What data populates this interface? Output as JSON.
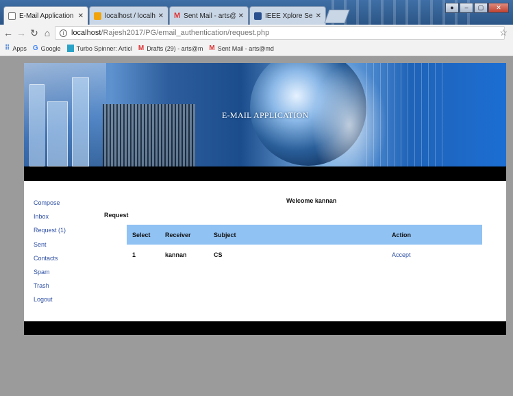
{
  "browser": {
    "tabs": [
      {
        "title": "E-Mail Application",
        "icon": "page-icon",
        "active": true
      },
      {
        "title": "localhost / localhost / g",
        "icon": "phpmyadmin-icon",
        "active": false
      },
      {
        "title": "Sent Mail - arts@mdcen",
        "icon": "gmail-icon",
        "active": false
      },
      {
        "title": "IEEE Xplore Search Resu",
        "icon": "ieee-icon",
        "active": false
      }
    ],
    "url_host": "localhost",
    "url_path": "/Rajesh2017/PG/email_authentication/request.php",
    "bookmarks": [
      {
        "label": "Apps",
        "icon": "apps-grid-icon"
      },
      {
        "label": "Google",
        "icon": "google-icon"
      },
      {
        "label": "Turbo Spinner: Articl",
        "icon": "turbo-spinner-icon"
      },
      {
        "label": "Drafts (29) - arts@m",
        "icon": "gmail-icon"
      },
      {
        "label": "Sent Mail - arts@md",
        "icon": "gmail-icon"
      }
    ]
  },
  "banner": {
    "title": "E-MAIL APPLICATION"
  },
  "welcome_text": "Welcome kannan",
  "sidebar": {
    "items": [
      {
        "label": "Compose"
      },
      {
        "label": "Inbox"
      },
      {
        "label": "Request (1)"
      },
      {
        "label": "Sent"
      },
      {
        "label": "Contacts"
      },
      {
        "label": "Spam"
      },
      {
        "label": "Trash"
      },
      {
        "label": "Logout"
      }
    ]
  },
  "request_heading": "Request",
  "table": {
    "headers": [
      "Select",
      "Receiver",
      "Subject",
      "Action"
    ],
    "rows": [
      {
        "select": "1",
        "receiver": "kannan",
        "subject": "CS",
        "action": "Accept"
      }
    ]
  },
  "colors": {
    "link": "#2e4fa3",
    "table_header_bg": "#90c2f3",
    "page_bg": "#9b9b9b",
    "bar": "#000000"
  }
}
